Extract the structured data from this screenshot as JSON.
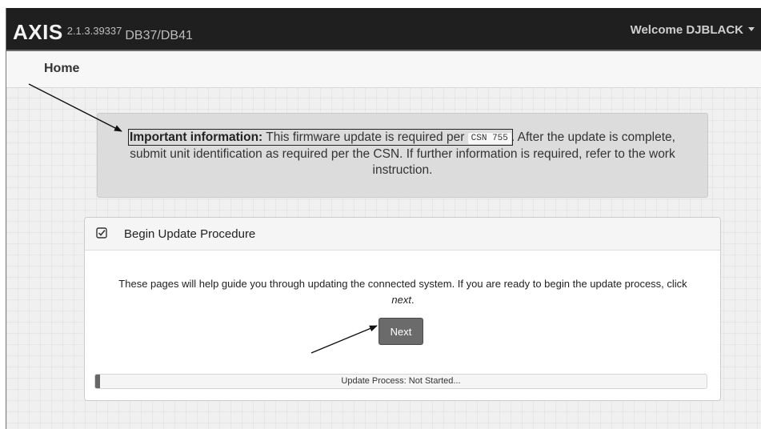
{
  "navbar": {
    "brand": "AXIS",
    "version": "2.1.3.39337",
    "model": "DB37/DB41",
    "user_menu": "Welcome DJBLACK"
  },
  "breadcrumb": {
    "home": "Home"
  },
  "alert": {
    "bold_label": "Important information:",
    "text_before_code": " This firmware update is required per ",
    "code": "CSN 755",
    "text_after_code": ". After the update is complete, submit unit identification as required per the CSN. If further information is required, refer to the work instruction."
  },
  "panel": {
    "icon": "checkbox-checked-icon",
    "title": "Begin Update Procedure",
    "description_main": "These pages will help guide you through updating the connected system. If you are ready to begin the update process, click ",
    "description_emphasis": "next",
    "description_end": ".",
    "next_label": "Next",
    "progress": {
      "fraction": 0.0,
      "label": "Update Process: Not Started..."
    }
  },
  "colors": {
    "navbar_bg": "#1f1f1f",
    "alert_bg": "#dcdcdc",
    "button_bg": "#6b6b6b",
    "progress_fill": "#666666"
  }
}
